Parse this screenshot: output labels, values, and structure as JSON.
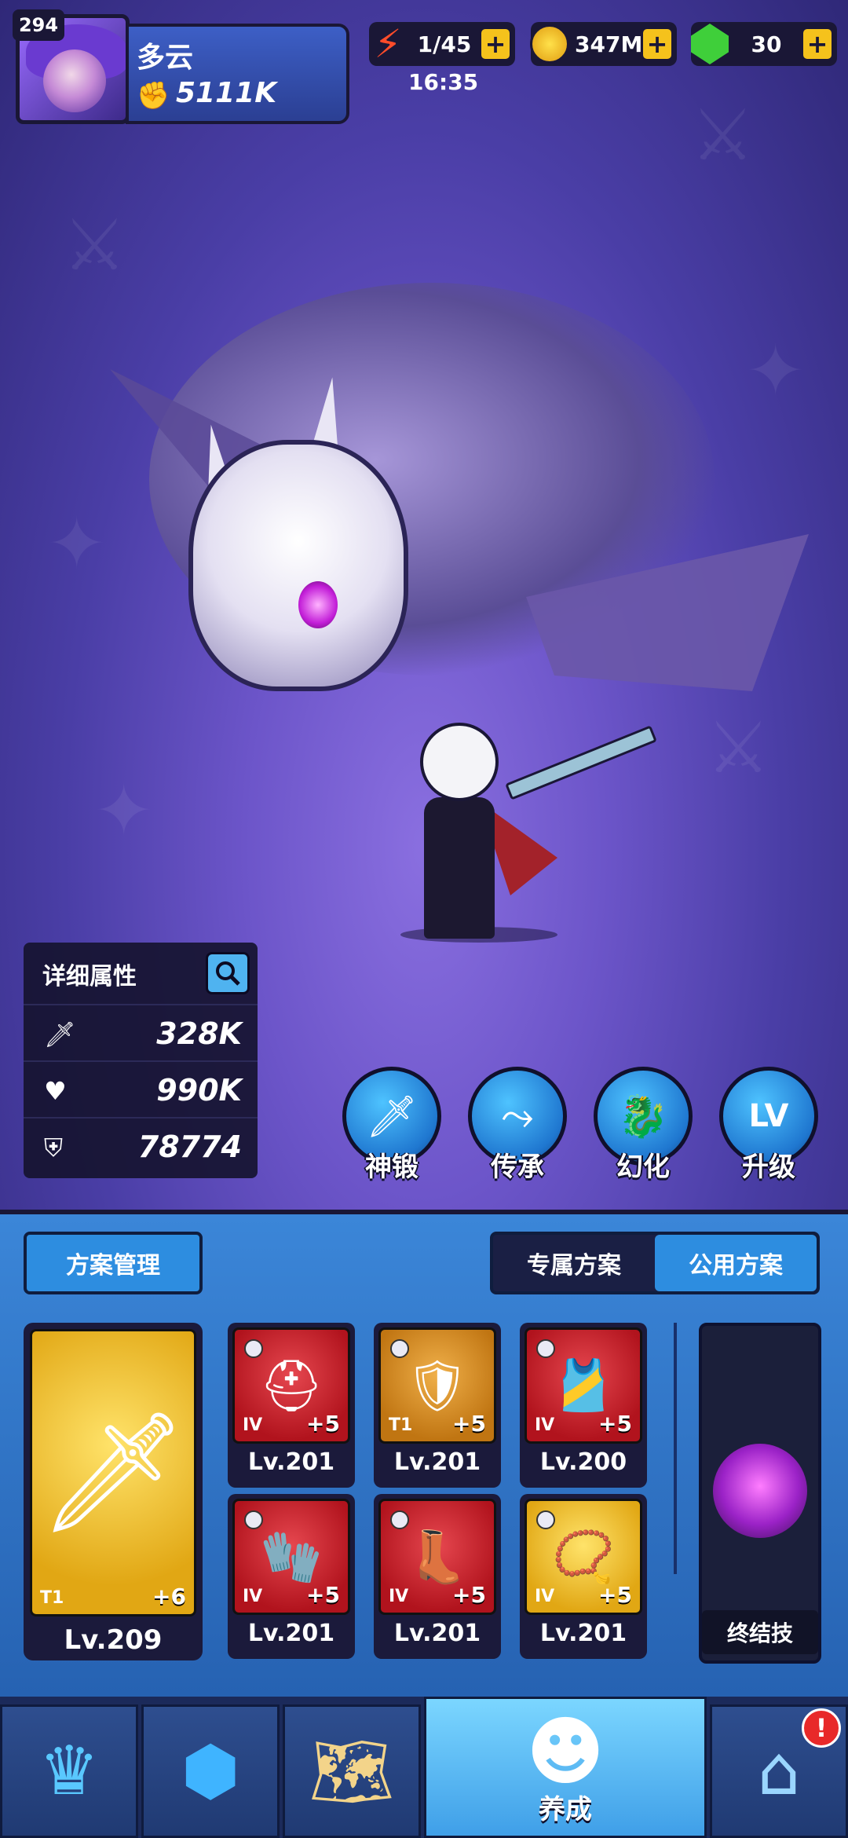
{
  "player": {
    "level": "294",
    "name": "多云",
    "power": "5111K"
  },
  "resources": {
    "energy": "1/45",
    "energy_timer": "16:35",
    "gold": "347M",
    "gems": "30"
  },
  "stats": {
    "title": "详细属性",
    "attack": "328K",
    "hp": "990K",
    "defense": "78774"
  },
  "actions": [
    {
      "label": "神锻",
      "icon": "sword-icon"
    },
    {
      "label": "传承",
      "icon": "share-nodes-icon"
    },
    {
      "label": "幻化",
      "icon": "dragon-icon"
    },
    {
      "label": "升级",
      "icon": "level-up-icon"
    }
  ],
  "panel": {
    "plan_button": "方案管理",
    "tab_exclusive": "专属方案",
    "tab_public": "公用方案",
    "main_weapon": {
      "tier": "T1",
      "plus": "+6",
      "level": "Lv.209"
    },
    "items": [
      {
        "tier": "IV",
        "plus": "+5",
        "level": "Lv.201",
        "icon": "helmet-icon"
      },
      {
        "tier": "T1",
        "plus": "+5",
        "level": "Lv.201",
        "icon": "chest-armor-icon"
      },
      {
        "tier": "IV",
        "plus": "+5",
        "level": "Lv.200",
        "icon": "belt-armor-icon"
      },
      {
        "tier": "IV",
        "plus": "+5",
        "level": "Lv.201",
        "icon": "gauntlet-icon"
      },
      {
        "tier": "IV",
        "plus": "+5",
        "level": "Lv.201",
        "icon": "boots-icon"
      },
      {
        "tier": "IV",
        "plus": "+5",
        "level": "Lv.201",
        "icon": "necklace-icon"
      }
    ],
    "finisher_label": "终结技"
  },
  "nav": {
    "active_label": "养成",
    "alert": "!"
  },
  "colors": {
    "accent_blue": "#2d8de0",
    "red_card": "#b1131d",
    "gold_card": "#e1a714"
  }
}
